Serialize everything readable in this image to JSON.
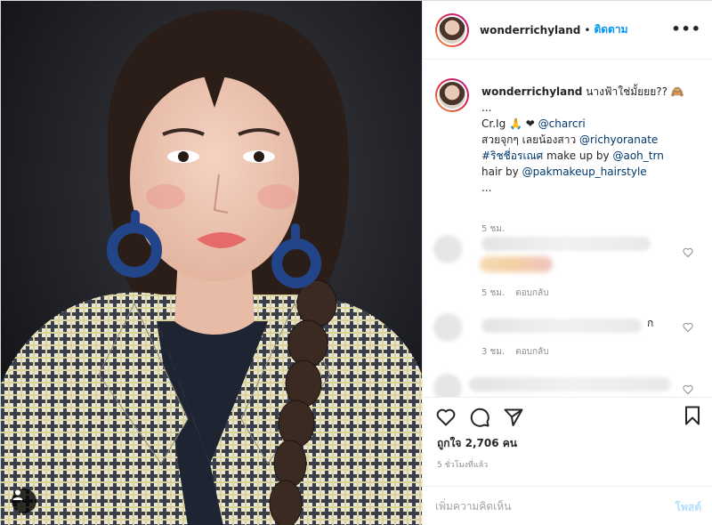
{
  "header": {
    "username": "wonderrichyland",
    "dot": "•",
    "follow_label": "ติดตาม",
    "more": "•••"
  },
  "caption": {
    "username": "wonderrichyland",
    "line1_text": "นางฟ้าใช่มั้ยยย?? 🙈",
    "line2": "...",
    "line3_prefix": "Cr.Ig 🙏 ❤",
    "line3_mention": "@charcri",
    "line4_text": "สวยจุกๆ เลยน้องสาว",
    "line4_mention": "@richyoranate",
    "line5_hashtag": "#ริชชี่อรเณศ",
    "line5_text": "make up by",
    "line5_mention": "@aoh_trn",
    "line6_text": "hair by",
    "line6_mention": "@pakmakeup_hairstyle",
    "line7": "...",
    "time": "5 ชม."
  },
  "comments": [
    {
      "time": "5 ชม.",
      "reply_label": "ตอบกลับ",
      "tail": ""
    },
    {
      "time": "3 ชม.",
      "reply_label": "ตอบกลับ",
      "tail": "ก"
    }
  ],
  "actions": {
    "likes": "ถูกใจ 2,706 คน",
    "post_time": "5 ชั่วโมงที่แล้ว"
  },
  "add_comment": {
    "placeholder": "เพิ่มความคิดเห็น",
    "post_label": "โพสต์"
  }
}
